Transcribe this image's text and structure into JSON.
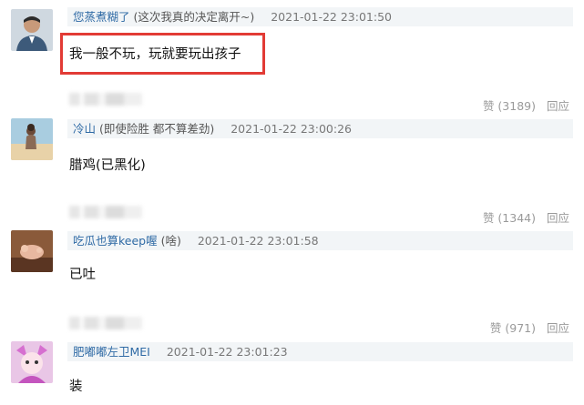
{
  "comments": [
    {
      "user": "您蒸煮糊了",
      "note": "(这次我真的决定离开~)",
      "time": "2021-01-22 23:01:50",
      "text": "我一般不玩，玩就要玩出孩子",
      "like": "赞 (3189)",
      "reply": "回应",
      "avatar_icon": "man-portrait-avatar"
    },
    {
      "user": "冷山",
      "note": "(即使险胜 都不算差劲)",
      "time": "2021-01-22 23:00:26",
      "text": "腊鸡(已黑化)",
      "like": "赞 (1344)",
      "reply": "回应",
      "avatar_icon": "beach-figure-avatar"
    },
    {
      "user": "吃瓜也算keep喔",
      "note": "(啥)",
      "time": "2021-01-22 23:01:58",
      "text": "已吐",
      "like": "赞 (971)",
      "reply": "回应",
      "avatar_icon": "toy-figure-avatar"
    },
    {
      "user": "肥嘟嘟左卫MEI",
      "note": "",
      "time": "2021-01-22 23:01:23",
      "text": "装",
      "like": "",
      "reply": "",
      "avatar_icon": "anime-character-avatar"
    }
  ],
  "colors": {
    "username": "#2f6aa5",
    "meta_background": "#f2f5f7",
    "highlight_border": "#e23b35",
    "footer_text": "#9a9a9a"
  }
}
